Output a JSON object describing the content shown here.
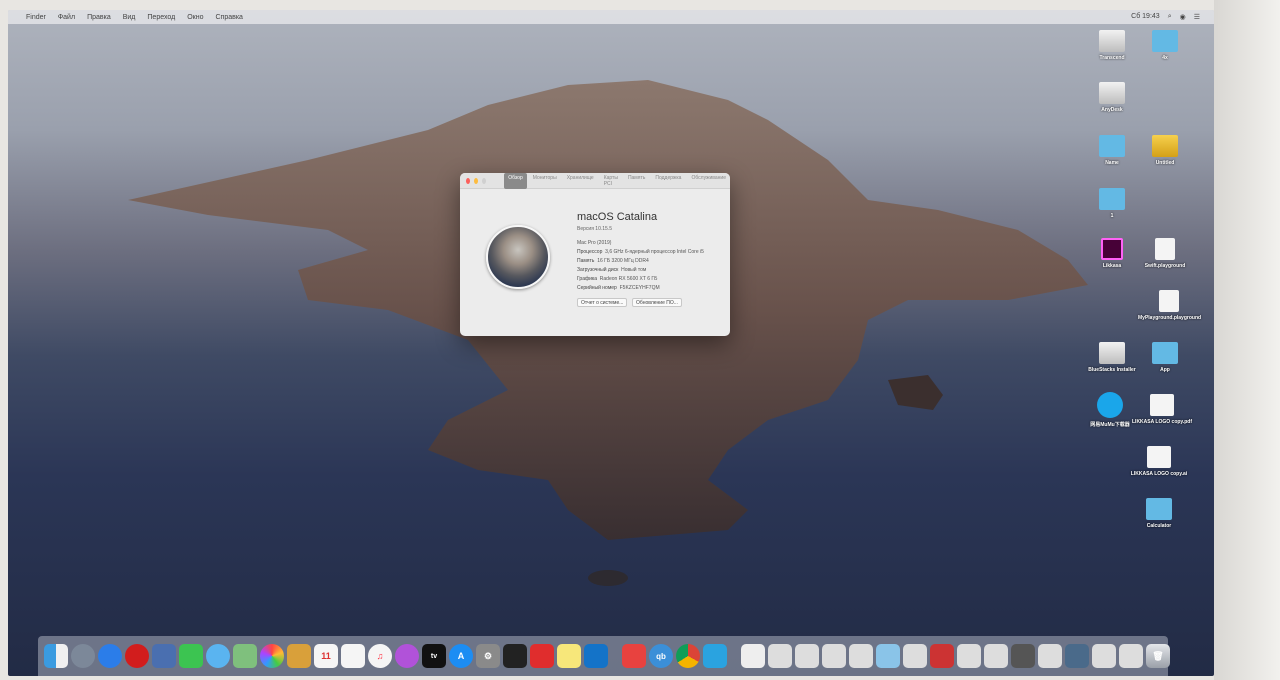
{
  "menubar": {
    "items": [
      "Finder",
      "Файл",
      "Правка",
      "Вид",
      "Переход",
      "Окно",
      "Справка"
    ],
    "clock": "Сб 19:43"
  },
  "about_window": {
    "tabs": [
      "Обзор",
      "Мониторы",
      "Хранилище",
      "Карты PCI",
      "Память",
      "Поддержка",
      "Обслуживание"
    ],
    "os_name": "macOS Catalina",
    "version": "Версия 10.15.5",
    "specs": [
      {
        "label": "Mac Pro (2019)",
        "value": ""
      },
      {
        "label": "Процессор",
        "value": "3,6 GHz 6-ядерный процессор Intel Core i5"
      },
      {
        "label": "Память",
        "value": "16 ГБ 3200 МГц DDR4"
      },
      {
        "label": "Загрузочный диск",
        "value": "Новый том"
      },
      {
        "label": "Графика",
        "value": "Radeon RX 5600 XT 6 ГБ"
      },
      {
        "label": "Серийный номер",
        "value": "F5KZCEYHF7QM"
      }
    ],
    "buttons": {
      "report": "Отчет о системе...",
      "update": "Обновление ПО..."
    }
  },
  "desktop_icons": [
    {
      "label": "Transcend",
      "kind": "drive"
    },
    {
      "label": "4x",
      "kind": "folder"
    },
    {
      "label": "AnyDesk",
      "kind": "drive"
    },
    {
      "label": "Name",
      "kind": "folder"
    },
    {
      "label": "Untitled",
      "kind": "yellow-drive"
    },
    {
      "label": "1",
      "kind": "folder"
    },
    {
      "label": "Likkasa",
      "kind": "xd-file"
    },
    {
      "label": "Swift.playground",
      "kind": "swift-file"
    },
    {
      "label": "MyPlayground.playground",
      "kind": "swift-file"
    },
    {
      "label": "BlueStacks Installer",
      "kind": "drive"
    },
    {
      "label": "App",
      "kind": "folder"
    },
    {
      "label": "网易MuMu下载器",
      "kind": "app"
    },
    {
      "label": "LIKKASA LOGO copy.pdf",
      "kind": "pdf"
    },
    {
      "label": "LIKKASA LOGO copy.ai",
      "kind": "ai-file"
    },
    {
      "label": "Calculator",
      "kind": "folder"
    }
  ],
  "dock": {
    "apps": [
      "finder-icon",
      "launchpad-icon",
      "safari-icon",
      "opera-icon",
      "photo-icon",
      "facetime-icon",
      "messages-icon",
      "maps-icon",
      "photos-icon",
      "notes-icon",
      "calendar-icon",
      "reminders-icon",
      "music-icon",
      "podcasts-icon",
      "tv-icon",
      "appstore-icon",
      "preferences-icon",
      "activity-icon",
      "anydesk-icon",
      "stickies-icon",
      "xcode-icon",
      "parallels-icon",
      "qbittorrent-icon",
      "chrome-icon",
      "script-icon"
    ],
    "docs": [
      "doc-1",
      "doc-2",
      "doc-3",
      "doc-4",
      "doc-5",
      "doc-6",
      "doc-7",
      "doc-8",
      "doc-9",
      "doc-10",
      "doc-11",
      "doc-12",
      "doc-13",
      "doc-14",
      "doc-15"
    ],
    "trash": "trash-icon"
  }
}
